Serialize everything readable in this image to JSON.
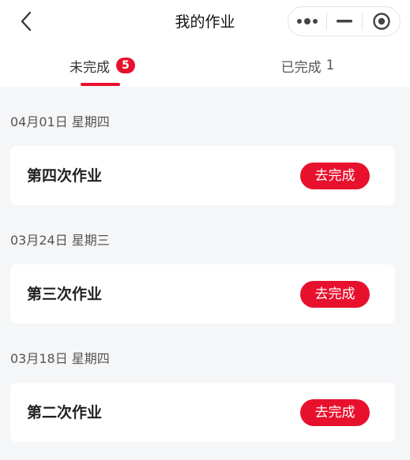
{
  "header": {
    "title": "我的作业",
    "back_icon": "chevron-left-icon",
    "capsule": {
      "more_icon": "more-dots-icon",
      "minimize_icon": "minus-icon",
      "close_icon": "target-circle-icon"
    }
  },
  "tabs": [
    {
      "label": "未完成",
      "badge": "5",
      "active": true
    },
    {
      "label": "已完成",
      "count": "1",
      "active": false
    }
  ],
  "groups": [
    {
      "date": "04月01日 星期四",
      "title": "第四次作业",
      "button": "去完成"
    },
    {
      "date": "03月24日 星期三",
      "title": "第三次作业",
      "button": "去完成"
    },
    {
      "date": "03月18日 星期四",
      "title": "第二次作业",
      "button": "去完成"
    }
  ],
  "colors": {
    "accent": "#e8112d",
    "background": "#f5f6f8",
    "card": "#ffffff"
  }
}
